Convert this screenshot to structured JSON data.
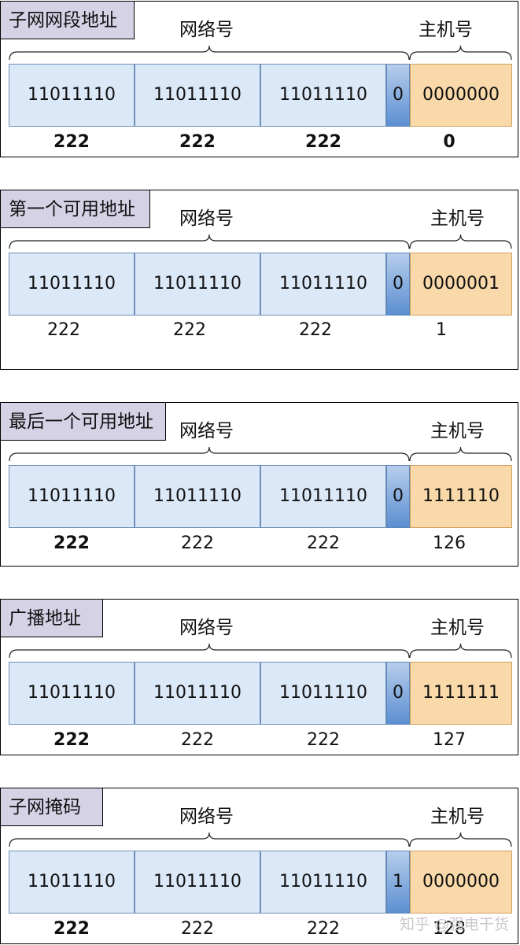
{
  "header_labels": {
    "network": "网络号",
    "host": "主机号"
  },
  "panels": [
    {
      "title": "子网网段地址",
      "bits": [
        "11011110",
        "11011110",
        "11011110",
        "0",
        "0000000"
      ],
      "decimals": [
        "222",
        "222",
        "222",
        "0"
      ],
      "bold_decimals": true
    },
    {
      "title": "第一个可用地址",
      "bits": [
        "11011110",
        "11011110",
        "11011110",
        "0",
        "0000001"
      ],
      "decimals": [
        "222",
        "222",
        "222",
        "1"
      ],
      "bold_decimals": false
    },
    {
      "title": "最后一个可用地址",
      "bits": [
        "11011110",
        "11011110",
        "11011110",
        "0",
        "1111110"
      ],
      "decimals": [
        "222",
        "222",
        "222",
        "126"
      ],
      "bold_decimals": false
    },
    {
      "title": "广播地址",
      "bits": [
        "11011110",
        "11011110",
        "11011110",
        "0",
        "1111111"
      ],
      "decimals": [
        "222",
        "222",
        "222",
        "127"
      ],
      "bold_decimals": false
    },
    {
      "title": "子网掩码",
      "bits": [
        "11011110",
        "11011110",
        "11011110",
        "1",
        "0000000"
      ],
      "decimals": [
        "222",
        "222",
        "222",
        "128"
      ],
      "bold_decimals": false
    }
  ],
  "watermark": "知乎 @强电干货",
  "colors": {
    "network": "#dbe8f8",
    "separator": "#5b8fd1",
    "host": "#f9d9a9",
    "tag": "#d6d2e6"
  }
}
